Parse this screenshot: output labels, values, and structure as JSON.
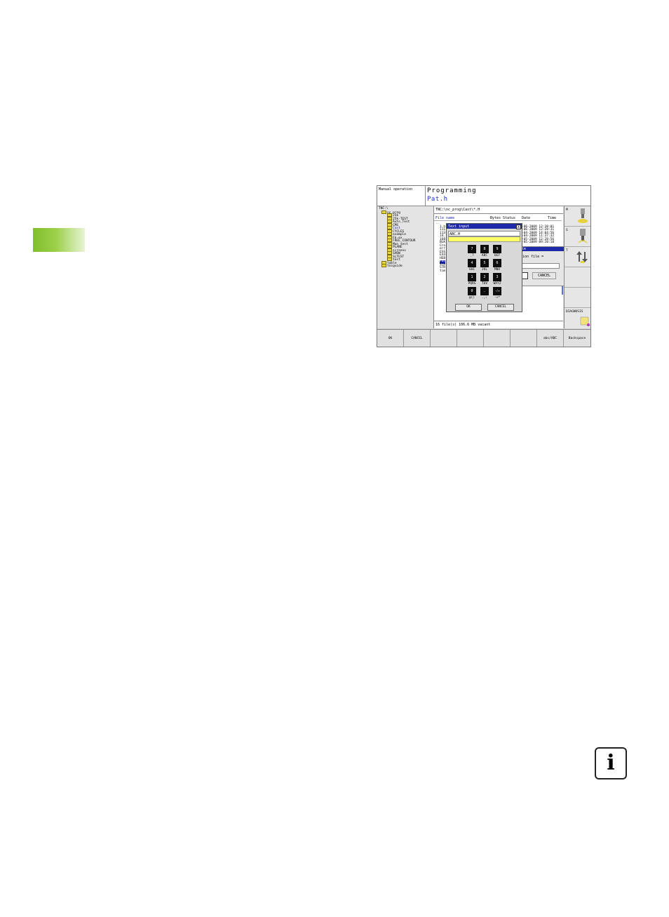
{
  "header": {
    "left": "Manual operation",
    "title": "Programming",
    "file": "Pat.h"
  },
  "tree": {
    "root": "TNC:\\",
    "items": [
      "nc_prog",
      "25k",
      "25k-TEST",
      "Auto_Test",
      "CMS",
      "Cast",
      "CYCLES",
      "example",
      "Fk-ex",
      "FREE_CONTOUR",
      "Man_test",
      "PLANE",
      "screens",
      "SHOW",
      "SLTEST",
      "test",
      "table",
      "tncguide"
    ]
  },
  "filelist": {
    "path": "TNC:\\nc_prog\\Cast\\*.H",
    "columns": [
      "File name",
      "Bytes",
      "Status",
      "Date",
      "Time"
    ],
    "names": [
      "..",
      "1.h",
      "111",
      "113",
      "14.",
      "168",
      "BLK",
      "Cro",
      "err",
      "ESS",
      "EX4",
      "HEB",
      "Pat",
      "STA",
      "STR",
      "tim"
    ],
    "dates": [
      "-06-2009 12:38:01",
      "-06-2009 12:28:31",
      "-04-2009 14:04:56",
      "-04-2009 11:37:32",
      "-05-2009 12:28:56",
      "-05-2009 09:28:18"
    ],
    "status": "16  file(s)  106.6 MB vacant"
  },
  "file_dialog": {
    "title": "le",
    "prompt": "ion file =",
    "cancel": "CANCEL"
  },
  "text_input": {
    "title": "Text input",
    "close": "X",
    "value": "ABC.H",
    "keys": [
      {
        "digit": "7",
        "label": "_?"
      },
      {
        "digit": "8",
        "label": "ABC"
      },
      {
        "digit": "9",
        "label": "DEF"
      },
      {
        "digit": "4",
        "label": "GHI"
      },
      {
        "digit": "5",
        "label": "JKL"
      },
      {
        "digit": "6",
        "label": "MNO"
      },
      {
        "digit": "1",
        "label": "PQRS"
      },
      {
        "digit": "2",
        "label": "TUV"
      },
      {
        "digit": "3",
        "label": "WXYZ"
      },
      {
        "digit": "0",
        "label": "@()"
      },
      {
        "digit": ".",
        "label": ".,:"
      },
      {
        "digit": "-/+",
        "label": "-+*"
      }
    ],
    "ok": "OK",
    "cancel": "CANCEL"
  },
  "softkeys_right": [
    "M",
    "S",
    "T",
    "",
    "",
    "DIAGNOSIS"
  ],
  "softkeys_bottom": [
    "OK",
    "CANCEL",
    "",
    "",
    "",
    "",
    "abc/ABC",
    "Backspace"
  ],
  "info_icon": "i"
}
